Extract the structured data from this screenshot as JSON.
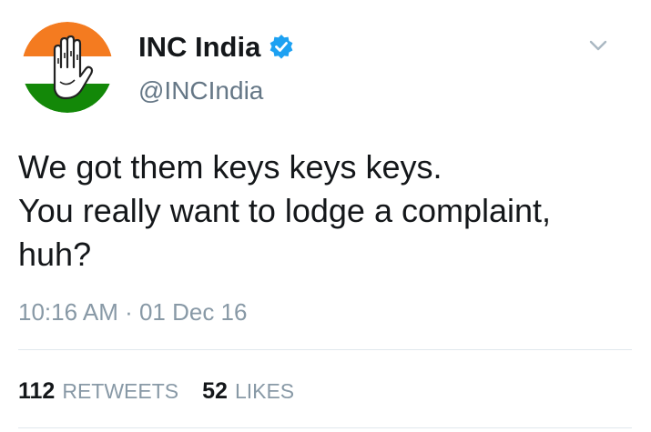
{
  "tweet": {
    "display_name": "INC India",
    "handle": "@INCIndia",
    "verified": true,
    "avatar_icon": "inc-hand-symbol-icon",
    "text_lines": [
      "We got them keys keys keys.",
      "You really want to lodge a complaint,",
      "huh?"
    ],
    "timestamp": "10:16 AM · 01 Dec 16",
    "retweets": {
      "count": "112",
      "label": "RETWEETS"
    },
    "likes": {
      "count": "52",
      "label": "LIKES"
    }
  },
  "colors": {
    "saffron": "#f47b20",
    "green": "#138808",
    "verified_blue": "#1da1f2",
    "muted_text": "#8899a6",
    "handle_text": "#657786"
  }
}
